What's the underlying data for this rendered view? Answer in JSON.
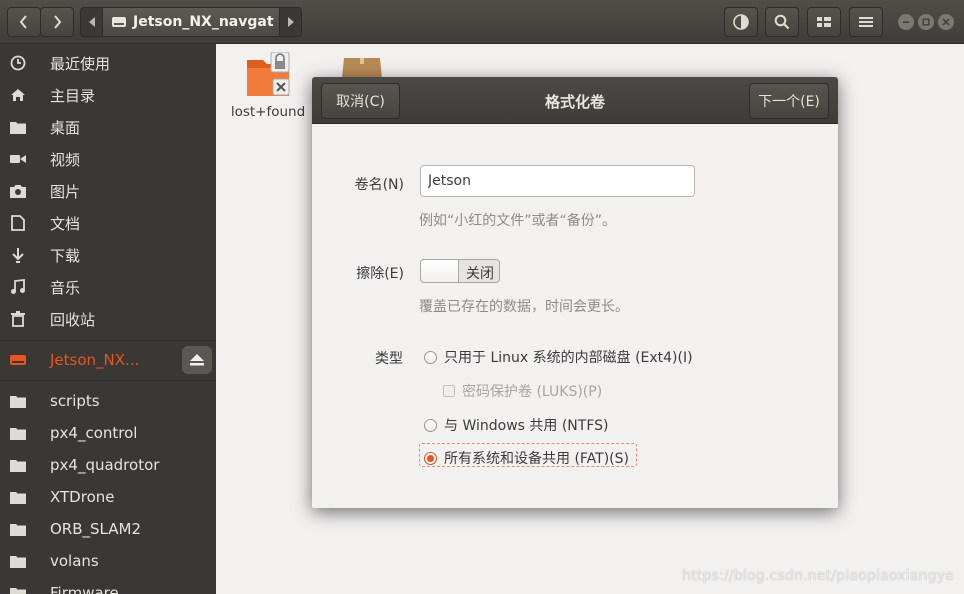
{
  "header": {
    "path_label": "Jetson_NX_navgat"
  },
  "sidebar": {
    "places": [
      {
        "label": "最近使用",
        "icon": "clock-icon"
      },
      {
        "label": "主目录",
        "icon": "home-icon"
      },
      {
        "label": "桌面",
        "icon": "folder-icon"
      },
      {
        "label": "视频",
        "icon": "video-icon"
      },
      {
        "label": "图片",
        "icon": "camera-icon"
      },
      {
        "label": "文档",
        "icon": "document-icon"
      },
      {
        "label": "下载",
        "icon": "download-icon"
      },
      {
        "label": "音乐",
        "icon": "music-icon"
      },
      {
        "label": "回收站",
        "icon": "trash-icon"
      }
    ],
    "device": {
      "label": "Jetson_NX...",
      "icon": "drive-icon",
      "accent": "#e95420"
    },
    "bookmarks": [
      {
        "label": "scripts"
      },
      {
        "label": "px4_control"
      },
      {
        "label": "px4_quadrotor"
      },
      {
        "label": "XTDrone"
      },
      {
        "label": "ORB_SLAM2"
      },
      {
        "label": "volans"
      },
      {
        "label": "Firmware"
      }
    ]
  },
  "content": {
    "files": [
      {
        "name": "lost+found",
        "icon": "locked-folder-icon"
      }
    ],
    "watermark": "https://blog.csdn.net/piaopiaoxiangye"
  },
  "dialog": {
    "title": "格式化卷",
    "cancel_label": "取消(C)",
    "next_label": "下一个(E)",
    "name_label": "卷名(N)",
    "name_value": "Jetson",
    "name_hint": "例如“小红的文件”或者“备份”。",
    "erase_label": "擦除(E)",
    "erase_state": "关闭",
    "erase_hint": "覆盖已存在的数据，时间会更长。",
    "type_label": "类型",
    "options": [
      {
        "label": "只用于 Linux 系统的内部磁盘 (Ext4)(I)",
        "selected": false
      },
      {
        "label": "密码保护卷 (LUKS)(P)",
        "checked": false,
        "disabled": true
      },
      {
        "label": "与 Windows 共用 (NTFS)",
        "selected": false
      },
      {
        "label": "所有系统和设备共用 (FAT)(S)",
        "selected": true
      }
    ]
  }
}
